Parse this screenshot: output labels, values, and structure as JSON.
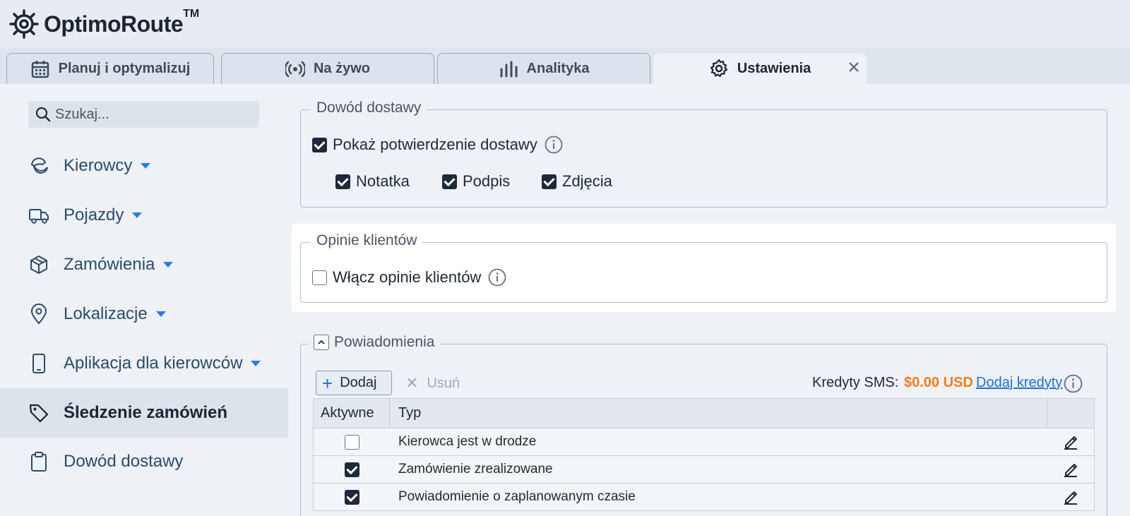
{
  "app": {
    "name": "OptimoRoute",
    "trademark": "TM"
  },
  "tabs": [
    {
      "label": "Planuj i optymalizuj",
      "icon": "calendar-icon"
    },
    {
      "label": "Na żywo",
      "icon": "live-broadcast-icon"
    },
    {
      "label": "Analityka",
      "icon": "bar-chart-icon"
    },
    {
      "label": "Ustawienia",
      "icon": "gear-icon",
      "active": true
    }
  ],
  "sidebar": {
    "search_placeholder": "Szukaj...",
    "items": [
      {
        "label": "Kierowcy",
        "icon": "driver-icon",
        "dropdown": true
      },
      {
        "label": "Pojazdy",
        "icon": "truck-icon",
        "dropdown": true
      },
      {
        "label": "Zamówienia",
        "icon": "box-icon",
        "dropdown": true
      },
      {
        "label": "Lokalizacje",
        "icon": "location-pin-icon",
        "dropdown": true
      },
      {
        "label": "Aplikacja dla kierowców",
        "icon": "phone-icon",
        "dropdown": true
      },
      {
        "label": "Śledzenie zamówień",
        "icon": "tag-icon",
        "active": true
      },
      {
        "label": "Dowód dostawy",
        "icon": "clipboard-icon"
      }
    ]
  },
  "proof_of_delivery": {
    "title": "Dowód dostawy",
    "show_confirmation": {
      "label": "Pokaż potwierdzenie dostawy",
      "checked": true
    },
    "options": [
      {
        "label": "Notatka",
        "checked": true
      },
      {
        "label": "Podpis",
        "checked": true
      },
      {
        "label": "Zdjęcia",
        "checked": true
      }
    ]
  },
  "customer_feedback": {
    "title": "Opinie klientów",
    "enable": {
      "label": "Włącz opinie klientów",
      "checked": false
    }
  },
  "notifications": {
    "title": "Powiadomienia",
    "add_label": "Dodaj",
    "remove_label": "Usuń",
    "sms_credits_label": "Kredyty SMS:",
    "sms_credits_value": "$0.00 USD",
    "add_credits_link": "Dodaj kredyty",
    "columns": [
      "Aktywne",
      "Typ"
    ],
    "rows": [
      {
        "active": false,
        "type": "Kierowca jest w drodze"
      },
      {
        "active": true,
        "type": "Zamówienie zrealizowane"
      },
      {
        "active": true,
        "type": "Powiadomienie o zaplanowanym czasie"
      }
    ]
  },
  "colors": {
    "accent": "#2c7be5",
    "credits": "#f07c1e",
    "dark": "#1e2a3b"
  }
}
